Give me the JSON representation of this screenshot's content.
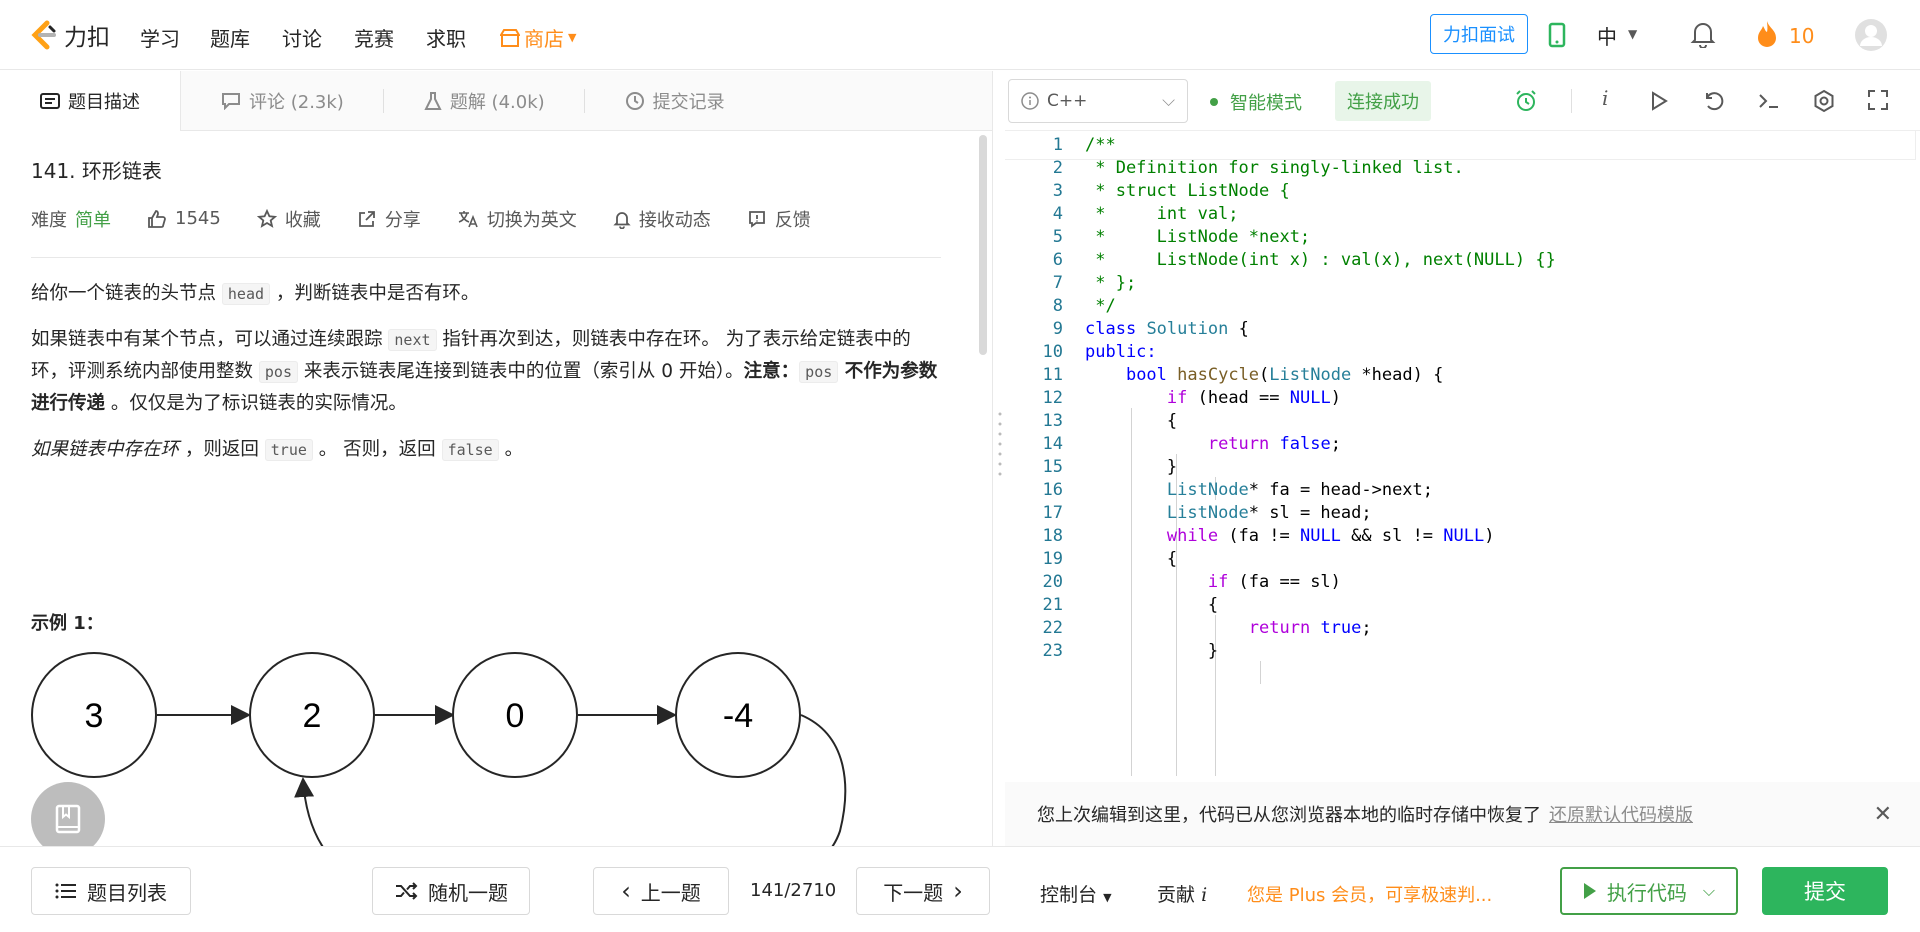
{
  "nav": {
    "logo_text": "力扣",
    "items": [
      "学习",
      "题库",
      "讨论",
      "竞赛",
      "求职"
    ],
    "shop": "商店",
    "interview": "力扣面试",
    "lang": "中",
    "streak": "10"
  },
  "tabs": [
    {
      "label": "题目描述"
    },
    {
      "label": "评论 (2.3k)"
    },
    {
      "label": "题解 (4.0k)"
    },
    {
      "label": "提交记录"
    }
  ],
  "problem": {
    "title": "141. 环形链表",
    "difficulty_label": "难度",
    "difficulty": "简单",
    "likes": "1545",
    "collect": "收藏",
    "share": "分享",
    "switch_en": "切换为英文",
    "subscribe": "接收动态",
    "feedback": "反馈",
    "p1_a": "给你一个链表的头节点 ",
    "p1_code": "head",
    "p1_b": " ，判断链表中是否有环。",
    "p2_a": "如果链表中有某个节点，可以通过连续跟踪 ",
    "p2_code": "next",
    "p2_b": " 指针再次到达，则链表中存在环。 为了表示给定链表中的环，评测系统内部使用整数 ",
    "p2_code2": "pos",
    "p2_c": " 来表示链表尾连接到链表中的位置（索引从 0 开始）。",
    "p2_note": "注意：",
    "p2_code3": "pos",
    "p2_bold": " 不作为参数进行传递",
    "p2_d": " 。仅仅是为了标识链表的实际情况。",
    "p3_italic": "如果链表中存在环",
    "p3_a": " ，则返回 ",
    "p3_code": "true",
    "p3_b": " 。 否则，返回 ",
    "p3_code2": "false",
    "p3_c": " 。",
    "example_title": "示例 1：",
    "nodes": [
      "3",
      "2",
      "0",
      "-4"
    ]
  },
  "editor": {
    "language": "C++",
    "smart_mode": "智能模式",
    "connected": "连接成功",
    "lines": [
      "/**",
      " * Definition for singly-linked list.",
      " * struct ListNode {",
      " *     int val;",
      " *     ListNode *next;",
      " *     ListNode(int x) : val(x), next(NULL) {}",
      " * };",
      " */",
      "class Solution {",
      "public:",
      "    bool hasCycle(ListNode *head) {",
      "        if (head == NULL)",
      "        {",
      "            return false;",
      "        }",
      "        ListNode* fa = head->next;",
      "        ListNode* sl = head;",
      "        while (fa != NULL && sl != NULL)",
      "        {",
      "            if (fa == sl)",
      "            {",
      "                return true;",
      "            }"
    ],
    "restore_msg": "您上次编辑到这里，代码已从您浏览器本地的临时存储中恢复了",
    "restore_link": "还原默认代码模版"
  },
  "bottom": {
    "list": "题目列表",
    "random": "随机一题",
    "prev": "上一题",
    "page": "141/2710",
    "next": "下一题",
    "console": "控制台",
    "contribute": "贡献",
    "plus_msg": "您是 Plus 会员，可享极速判...",
    "run": "执行代码",
    "submit": "提交"
  },
  "colors": {
    "accent_green": "#2db55d",
    "orange": "#ff8d1a",
    "blue": "#1a90ff"
  }
}
